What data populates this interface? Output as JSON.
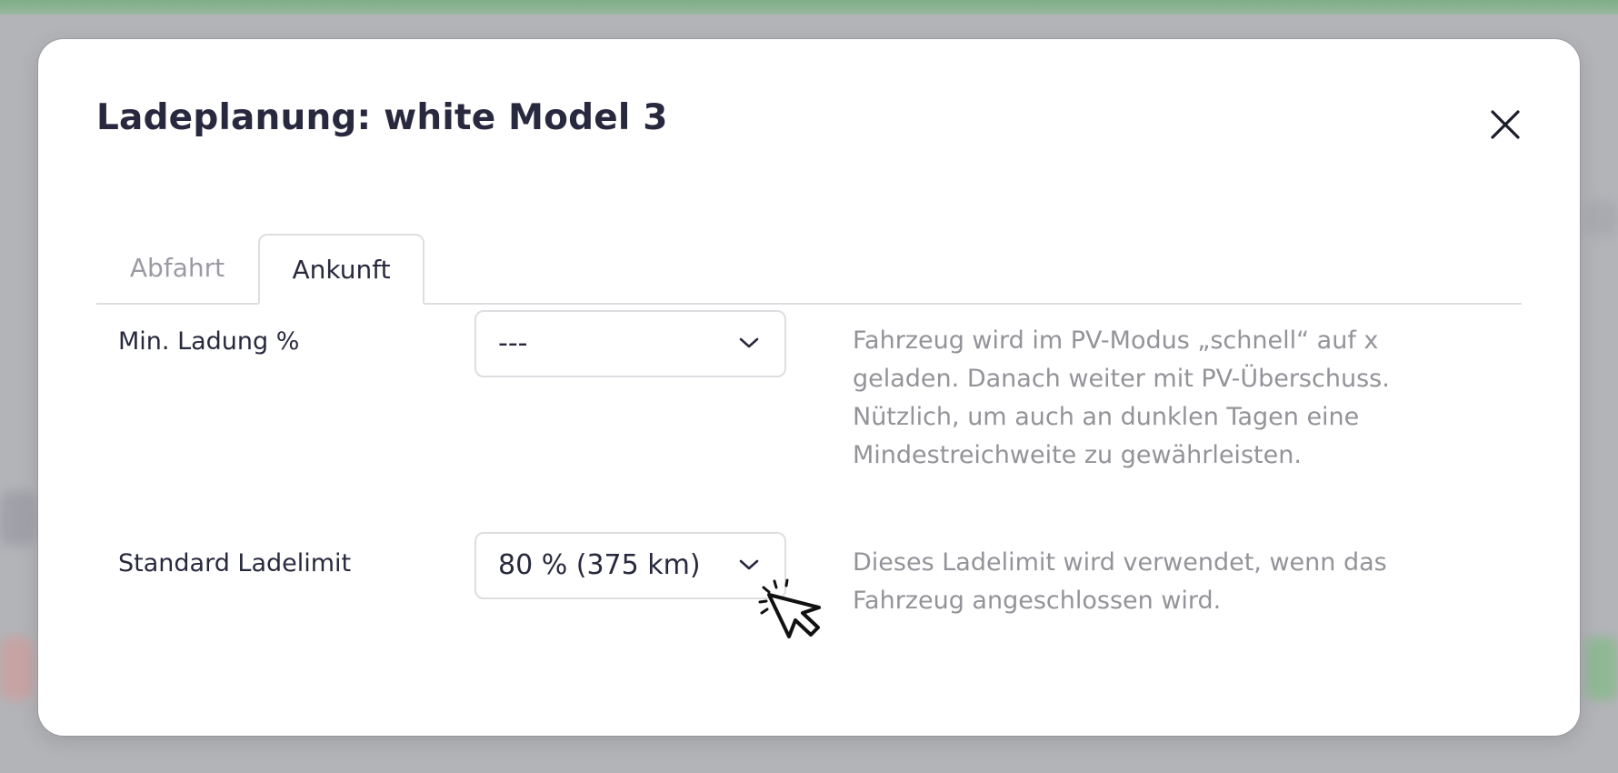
{
  "modal": {
    "title": "Ladeplanung: white Model 3",
    "tabs": [
      {
        "label": "Abfahrt",
        "active": false
      },
      {
        "label": "Ankunft",
        "active": true
      }
    ]
  },
  "fields": [
    {
      "label": "Min. Ladung %",
      "selected": "---",
      "help": "Fahrzeug wird im PV-Modus „schnell“ auf x geladen. Danach weiter mit PV-Überschuss. Nützlich, um auch an dunklen Tagen eine Mindestreichweite zu gewährleisten."
    },
    {
      "label": "Standard Ladelimit",
      "selected": "80 % (375 km)",
      "help": "Dieses Ladelimit wird verwendet, wenn das Fahrzeug angeschlossen wird."
    }
  ],
  "icons": {
    "close": "close-icon",
    "chevron": "chevron-down-icon",
    "cursor": "pointer-cursor-icon"
  },
  "colors": {
    "title": "#28293e",
    "help_text": "#939399",
    "border": "#dedee2",
    "backdrop": "#b3b4b8",
    "top_accent": "#7fae86"
  }
}
